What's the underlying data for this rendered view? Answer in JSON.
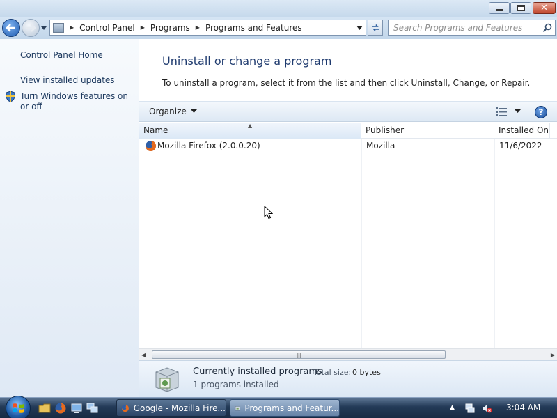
{
  "window": {
    "minimize_label": "Minimize",
    "maximize_label": "Maximize",
    "close_label": "Close"
  },
  "navigation": {
    "breadcrumbs": [
      "Control Panel",
      "Programs",
      "Programs and Features"
    ],
    "search_placeholder": "Search Programs and Features"
  },
  "left_pane": {
    "links": [
      "Control Panel Home",
      "View installed updates",
      "Turn Windows features on or off"
    ]
  },
  "main": {
    "title": "Uninstall or change a program",
    "description": "To uninstall a program, select it from the list and then click Uninstall, Change, or Repair.",
    "organize_label": "Organize",
    "columns": [
      "Name",
      "Publisher",
      "Installed On"
    ],
    "programs": [
      {
        "name": "Mozilla Firefox (2.0.0.20)",
        "publisher": "Mozilla",
        "installed_on": "11/6/2022"
      }
    ]
  },
  "details": {
    "title": "Currently installed programs",
    "total_size_label": "Total size:",
    "total_size_value": "0 bytes",
    "count_text": "1 programs installed"
  },
  "taskbar": {
    "buttons": [
      "Google - Mozilla Fire...",
      "Programs and Featur..."
    ],
    "clock": "3:04 AM"
  },
  "colors": {
    "title_text": "#1e3a6e",
    "link_text": "#1e3a5f",
    "taskbar": "#233a57"
  }
}
